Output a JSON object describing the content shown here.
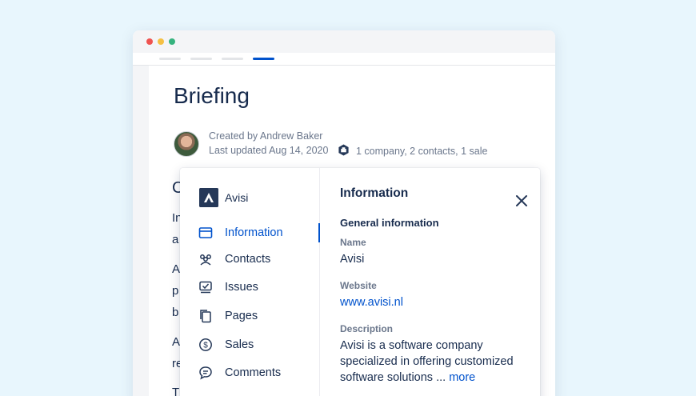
{
  "page": {
    "title": "Briefing",
    "created_by": "Created by Andrew Baker",
    "last_updated": "Last updated Aug 14, 2020",
    "hub_summary": "1 company, 2 contacts, 1 sale",
    "body_fragments": [
      "C",
      "In",
      "a",
      "A",
      "p",
      "b",
      "A",
      "re",
      "T"
    ]
  },
  "panel": {
    "company_name": "Avisi",
    "nav": [
      {
        "label": "Information",
        "icon": "card-icon",
        "active": true
      },
      {
        "label": "Contacts",
        "icon": "people-icon",
        "active": false
      },
      {
        "label": "Issues",
        "icon": "issues-icon",
        "active": false
      },
      {
        "label": "Pages",
        "icon": "pages-icon",
        "active": false
      },
      {
        "label": "Sales",
        "icon": "dollar-icon",
        "active": false
      },
      {
        "label": "Comments",
        "icon": "comment-icon",
        "active": false
      }
    ],
    "info": {
      "title": "Information",
      "section": "General information",
      "name_label": "Name",
      "name_value": "Avisi",
      "website_label": "Website",
      "website_value": "www.avisi.nl",
      "description_label": "Description",
      "description_line1": "Avisi is a software company",
      "description_line2": "specialized in offering customized",
      "description_line3": "software solutions ...",
      "more_link": "more"
    }
  },
  "colors": {
    "background": "#e8f6fd",
    "accent": "#0052cc",
    "text": "#172b4d",
    "muted": "#6b778c"
  }
}
